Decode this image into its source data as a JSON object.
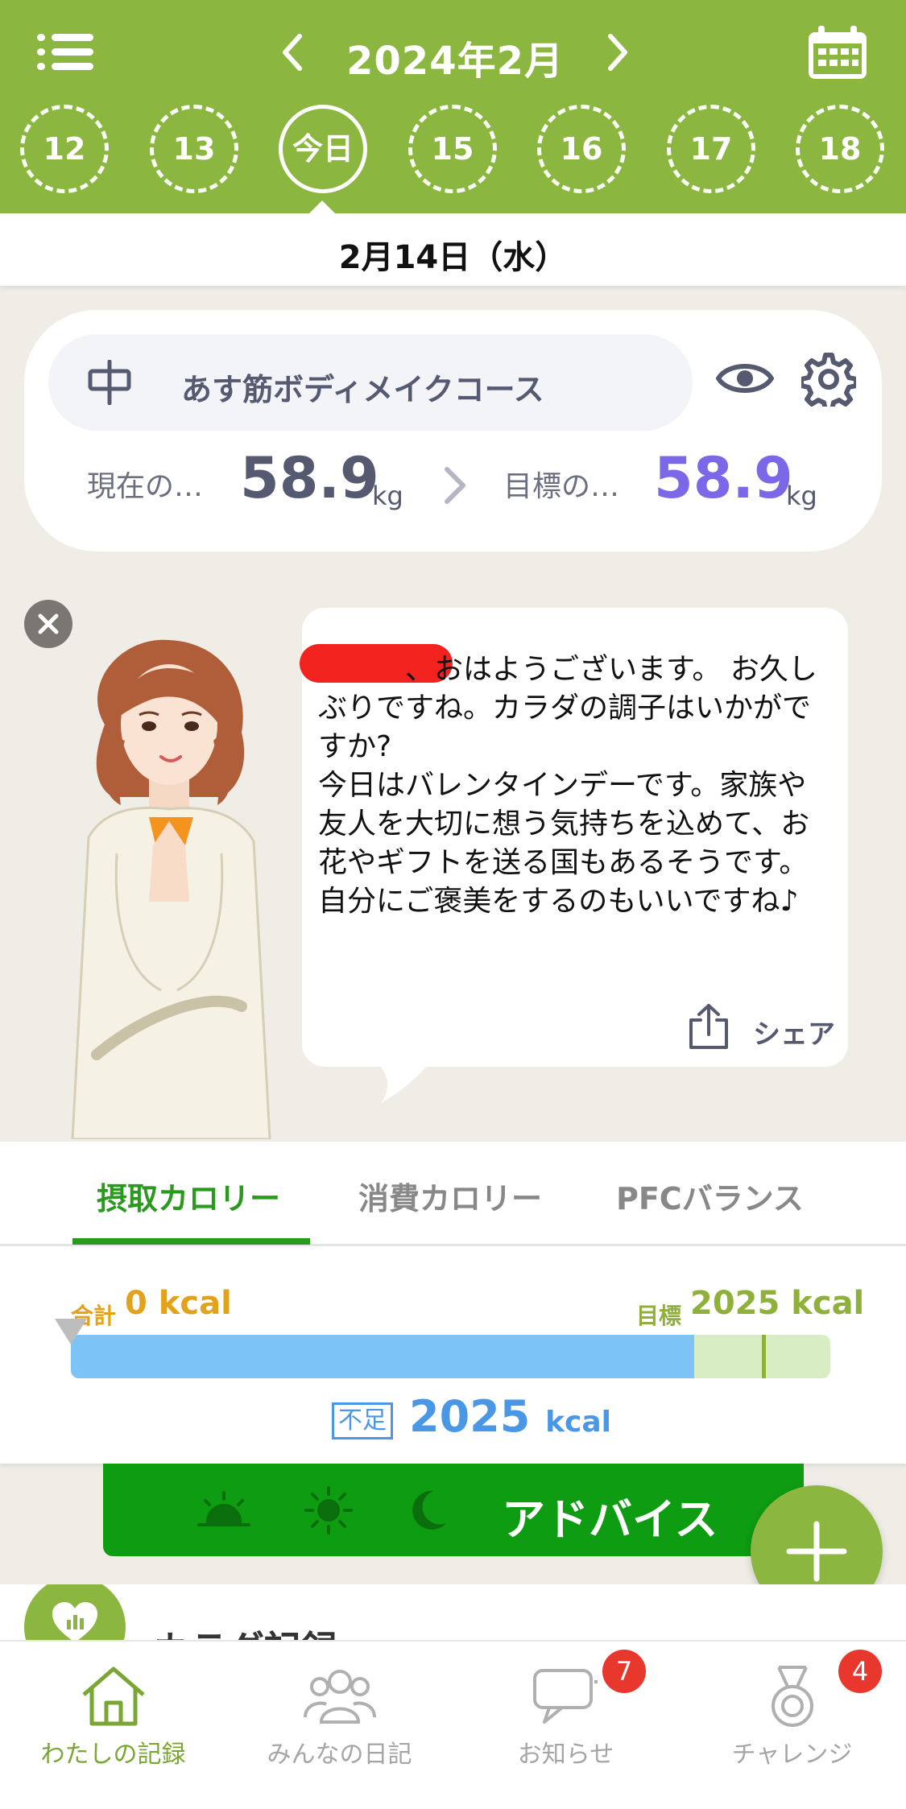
{
  "header": {
    "month_title": "2024年2月",
    "days": [
      "12",
      "13",
      "今日",
      "15",
      "16",
      "17",
      "18"
    ],
    "selected_date": "2月14日（水）",
    "accent_color": "#8bb63f"
  },
  "course": {
    "name": "あす筋ボディメイクコース",
    "current_label": "現在の…",
    "current_value": "58.9",
    "target_label": "目標の…",
    "target_value": "58.9",
    "unit": "kg",
    "current_color": "#555a70",
    "target_color": "#7b68e8"
  },
  "coach": {
    "message": "　　　、おはようございます。 お久しぶりですね。カラダの調子はいかがですか?\n今日はバレンタインデーです。家族や友人を大切に想う気持ちを込めて、お花やギフトを送る国もあるそうです。自分にご褒美をするのもいいですね♪",
    "share_label": "シェア"
  },
  "calories": {
    "tabs": [
      "摂取カロリー",
      "消費カロリー",
      "PFCバランス"
    ],
    "active_tab": 0,
    "total_label": "合計",
    "total_value": "0 kcal",
    "goal_label": "目標",
    "goal_value": "2025 kcal",
    "short_label": "不足",
    "short_value": "2025",
    "short_unit": "kcal",
    "fill_fraction": 0.821,
    "goal_marker_fraction": 0.91
  },
  "advice": {
    "label": "アドバイス",
    "icons": [
      "sunrise-icon",
      "sun-icon",
      "moon-icon"
    ]
  },
  "body_record": {
    "title": "カラダ記録"
  },
  "bottom_nav": [
    {
      "label": "わたしの記録",
      "icon": "home-icon",
      "badge": ""
    },
    {
      "label": "みんなの日記",
      "icon": "people-icon",
      "badge": ""
    },
    {
      "label": "お知らせ",
      "icon": "chat-icon",
      "badge": "7"
    },
    {
      "label": "チャレンジ",
      "icon": "medal-icon",
      "badge": "4"
    }
  ]
}
